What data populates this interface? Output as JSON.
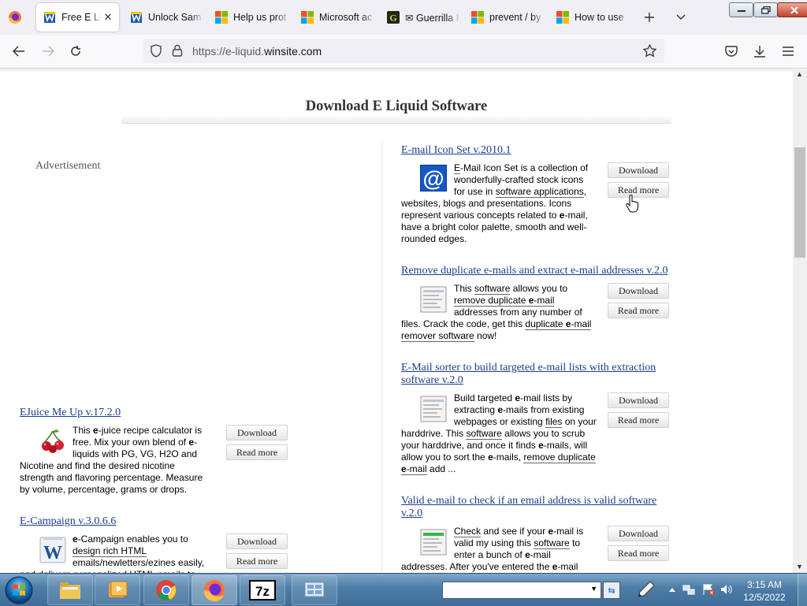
{
  "browser": {
    "tabs": [
      {
        "title": "Free E Liq",
        "active": true,
        "icon": "winsite-icon"
      },
      {
        "title": "Unlock Sam",
        "active": false,
        "icon": "winsite-icon"
      },
      {
        "title": "Help us prot",
        "active": false,
        "icon": "microsoft-icon"
      },
      {
        "title": "Microsoft ac",
        "active": false,
        "icon": "microsoft-icon"
      },
      {
        "title": "✉ Guerrilla M",
        "active": false,
        "icon": "guerrilla-mail-icon"
      },
      {
        "title": "prevent / by",
        "active": false,
        "icon": "microsoft-icon"
      },
      {
        "title": "How to use",
        "active": false,
        "icon": "microsoft-icon"
      }
    ],
    "close_glyph": "✕",
    "url_prefix": "https://e-liquid.",
    "url_domain": "winsite.com"
  },
  "page": {
    "heading": "Download E Liquid Software",
    "advertisement_label": "Advertisement",
    "download_label": "Download",
    "readmore_label": "Read more",
    "right_entries": [
      {
        "title": "E-mail Icon Set  v.2010.1",
        "desc_html": "<span class=\"kw\">E</span>-Mail Icon Set is a collection of wonderfully-crafted stock icons for use in <span class=\"kw\">software applications</span>, websites, blogs and presentations. Icons represent various concepts related to <b>e</b>-mail, have a bright color palette, smooth and well-rounded edges."
      },
      {
        "title": "Remove duplicate e-mails and extract e-mail addresses  v.2.0",
        "desc_html": "This <span class=\"kw\">software</span> allows you to <span class=\"kw\">remove duplicate <b>e</b>-mail</span> addresses from any number of files. Crack the code, get this <span class=\"kw\">duplicate <b>e</b>-mail remover software</span> now!"
      },
      {
        "title": "E-Mail sorter to build targeted e-mail lists with extraction software  v.2.0",
        "desc_html": "Build targeted <b>e</b>-mail lists by extracting <b>e</b>-mails from existing webpages or existing <span class=\"kw\">files</span> on your harddrive. This <span class=\"kw\">software</span> allows you to scrub your harddrive, and once it finds <b>e</b>-mails, will allow you to sort the <b>e</b>-mails, <span class=\"kw\">remove duplicate <b>e</b>-mail</span> add ..."
      },
      {
        "title": "Valid e-mail to check if an email address is valid software  v.2.0",
        "desc_html": "<span class=\"kw\">Check</span> and see if your <b>e</b>-mail is valid my using this <span class=\"kw\">software</span> to enter a bunch of <b>e</b>-mail addresses. After you've entered the <b>e</b>-mail"
      }
    ],
    "left_entries": [
      {
        "title": "EJuice Me Up  v.17.2.0",
        "desc_html": "This <b>e</b>-juice recipe calculator is free. Mix your own blend of <b>e</b>-liquids with PG, VG, H2O and Nicotine and find the desired nicotine strength and flavoring percentage. Measure by volume, percentage, grams or drops."
      },
      {
        "title": "E-Campaign  v.3.0.6.6",
        "desc_html": "<b>e</b>-Campaign enables you to <span class=\"kw\">design rich HTML</span> emails/newletters/ezines easily, and delivers personalized HTML emails to"
      }
    ]
  },
  "taskbar": {
    "time": "3:15 AM",
    "date": "12/5/2022",
    "search_value": ""
  },
  "colors": {
    "link": "#1a3d8c",
    "taskbar": "#4f7fa8",
    "heading": "#333333"
  }
}
